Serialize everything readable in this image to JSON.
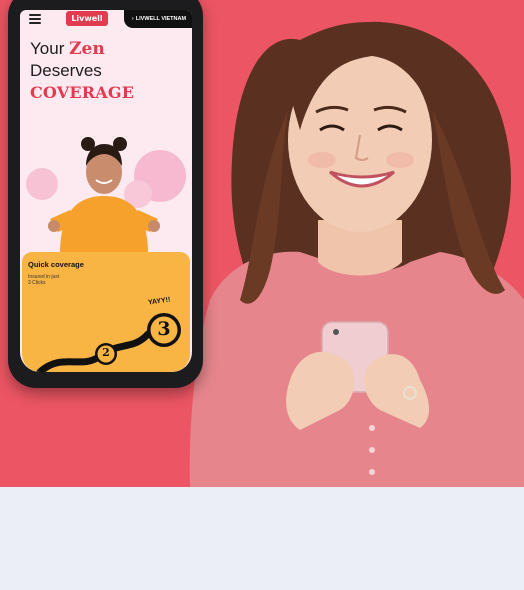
{
  "phone": {
    "brand_logo": "Livwell",
    "region_label": "LIVWELL VIETNAM",
    "headline": {
      "line1_prefix": "Your",
      "line1_accent": "Zen",
      "line2": "Deserves",
      "line3": "COVERAGE"
    },
    "card": {
      "title": "Quick coverage",
      "subtitle_line1": "Insured in just",
      "subtitle_line2": "3 Clicks",
      "step2": "2",
      "step3": "3",
      "celebration": "YAYY!!"
    }
  },
  "colors": {
    "hero_bg": "#ec5563",
    "accent": "#e23a4f",
    "card_bg": "#f9b544",
    "page_bg": "#eceef7"
  }
}
